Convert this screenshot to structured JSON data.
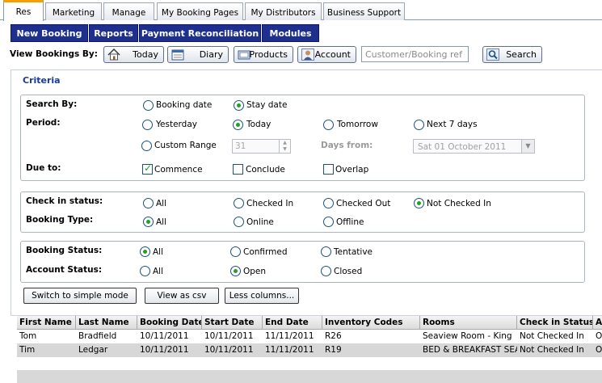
{
  "tabs": [
    "Res",
    "Marketing",
    "Manage",
    "My Booking Pages",
    "My Distributors",
    "Business Support"
  ],
  "nav": [
    "New Booking",
    "Reports",
    "Payment Reconciliation",
    "Modules"
  ],
  "view_bookings": {
    "label": "View Bookings By:",
    "buttons": [
      "Today",
      "Diary",
      "Products",
      "Account"
    ],
    "search_placeholder": "Customer/Booking ref",
    "search_button": "Search"
  },
  "criteria": {
    "legend": "Criteria",
    "search_by": {
      "label": "Search By:",
      "options": [
        "Booking date",
        "Stay date"
      ],
      "selected": "Stay date"
    },
    "period": {
      "label": "Period:",
      "options": [
        "Yesterday",
        "Today",
        "Tomorrow",
        "Next 7 days",
        "Custom Range"
      ],
      "selected": "Today"
    },
    "custom_days": "31",
    "days_from_label": "Days from:",
    "days_from_value": "Sat  01  October  2011",
    "due_to": {
      "label": "Due to:",
      "options": [
        "Commence",
        "Conclude",
        "Overlap"
      ],
      "checked": [
        "Commence"
      ]
    },
    "check_in_status": {
      "label": "Check in status:",
      "options": [
        "All",
        "Checked In",
        "Checked Out",
        "Not Checked In"
      ],
      "selected": "Not Checked In"
    },
    "booking_type": {
      "label": "Booking Type:",
      "options": [
        "All",
        "Online",
        "Offline"
      ],
      "selected": "All"
    },
    "booking_status": {
      "label": "Booking Status:",
      "options": [
        "All",
        "Confirmed",
        "Tentative"
      ],
      "selected": "All"
    },
    "account_status": {
      "label": "Account Status:",
      "options": [
        "All",
        "Open",
        "Closed"
      ],
      "selected": "Open"
    }
  },
  "actions": [
    "Switch to simple mode",
    "View as csv",
    "Less columns..."
  ],
  "table": {
    "columns": [
      "First Name",
      "Last Name",
      "Booking Date",
      "Start Date",
      "End Date",
      "Inventory Codes",
      "Rooms",
      "Check in Status",
      "A"
    ],
    "rows": [
      [
        "Tom",
        "Bradfield",
        "10/11/2011",
        "10/11/2011",
        "11/11/2011",
        "R26",
        "Seaview Room - King",
        "Not Checked In",
        "O"
      ],
      [
        "Tim",
        "Ledgar",
        "10/11/2011",
        "10/11/2011",
        "11/11/2011",
        "R19",
        "BED  &  BREAKFAST SEA",
        "Not Checked In",
        "O"
      ]
    ]
  },
  "colors": {
    "nav_bg": "#1e2f8e",
    "legend": "#1a3a9a",
    "tab_active_accent": "#f5a000",
    "radio_dot": "#21a121",
    "row_selected": "#d7d7d7"
  }
}
